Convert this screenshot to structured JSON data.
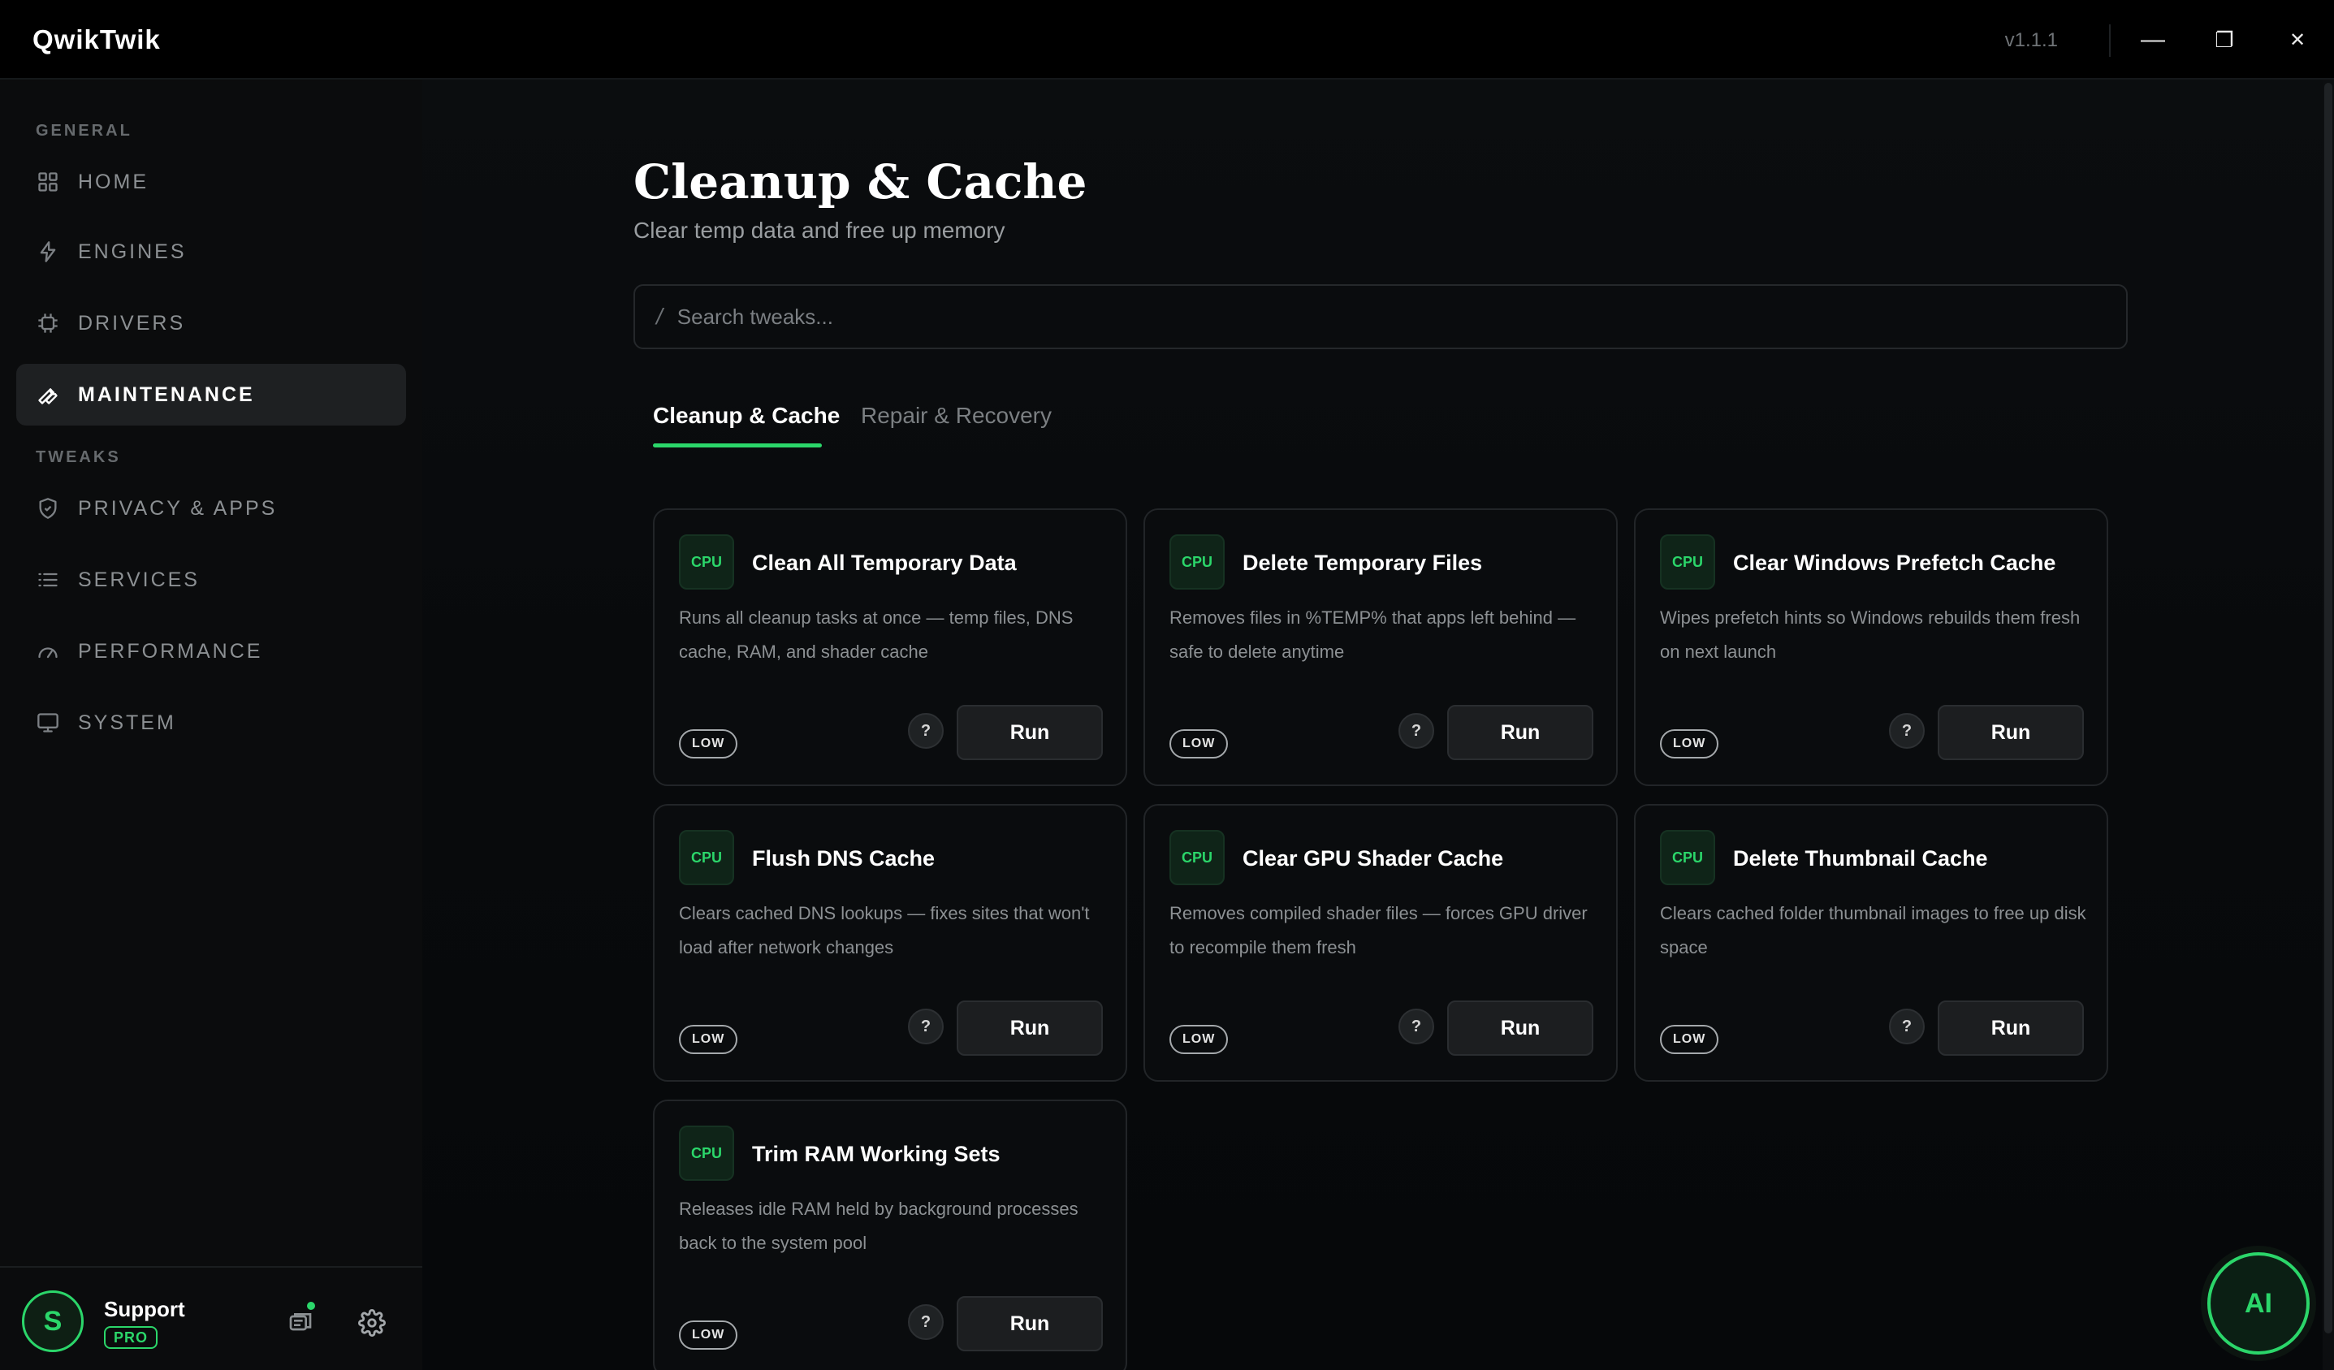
{
  "app": {
    "title": "QwikTwik",
    "version": "v1.1.1"
  },
  "window_controls": {
    "minimize": "—",
    "maximize": "❐",
    "close": "✕"
  },
  "sidebar": {
    "sections": [
      {
        "label": "GENERAL"
      },
      {
        "label": "TWEAKS"
      }
    ],
    "items": [
      {
        "label": "HOME",
        "icon": "grid-icon"
      },
      {
        "label": "ENGINES",
        "icon": "bolt-icon"
      },
      {
        "label": "DRIVERS",
        "icon": "chip-icon"
      },
      {
        "label": "MAINTENANCE",
        "icon": "wrench-icon",
        "active": true
      },
      {
        "label": "PRIVACY & APPS",
        "icon": "shield-icon"
      },
      {
        "label": "SERVICES",
        "icon": "list-icon"
      },
      {
        "label": "PERFORMANCE",
        "icon": "gauge-icon"
      },
      {
        "label": "SYSTEM",
        "icon": "monitor-icon"
      }
    ],
    "footer": {
      "avatar_initial": "S",
      "user_name": "Support",
      "plan_badge": "PRO"
    }
  },
  "main": {
    "title": "Cleanup & Cache",
    "subtitle": "Clear temp data and free up memory",
    "search": {
      "prefix": "/",
      "placeholder": "Search tweaks..."
    },
    "tabs": [
      {
        "label": "Cleanup & Cache",
        "active": true
      },
      {
        "label": "Repair & Recovery",
        "active": false
      }
    ],
    "cards": [
      {
        "category": "CPU",
        "title": "Clean All Temporary Data",
        "description": "Runs all cleanup tasks at once — temp files, DNS cache, RAM, and shader cache",
        "risk": "LOW",
        "help": "?",
        "action": "Run"
      },
      {
        "category": "CPU",
        "title": "Delete Temporary Files",
        "description": "Removes files in %TEMP% that apps left behind — safe to delete anytime",
        "risk": "LOW",
        "help": "?",
        "action": "Run"
      },
      {
        "category": "CPU",
        "title": "Clear Windows Prefetch Cache",
        "description": "Wipes prefetch hints so Windows rebuilds them fresh on next launch",
        "risk": "LOW",
        "help": "?",
        "action": "Run"
      },
      {
        "category": "CPU",
        "title": "Flush DNS Cache",
        "description": "Clears cached DNS lookups — fixes sites that won't load after network changes",
        "risk": "LOW",
        "help": "?",
        "action": "Run"
      },
      {
        "category": "CPU",
        "title": "Clear GPU Shader Cache",
        "description": "Removes compiled shader files — forces GPU driver to recompile them fresh",
        "risk": "LOW",
        "help": "?",
        "action": "Run"
      },
      {
        "category": "CPU",
        "title": "Delete Thumbnail Cache",
        "description": "Clears cached folder thumbnail images to free up disk space",
        "risk": "LOW",
        "help": "?",
        "action": "Run"
      },
      {
        "category": "CPU",
        "title": "Trim RAM Working Sets",
        "description": "Releases idle RAM held by background processes back to the system pool",
        "risk": "LOW",
        "help": "?",
        "action": "Run"
      }
    ]
  },
  "ai_button": {
    "label": "AI"
  },
  "colors": {
    "accent": "#2bd66a",
    "background": "#000000",
    "card_background": "#0a0c0e"
  }
}
